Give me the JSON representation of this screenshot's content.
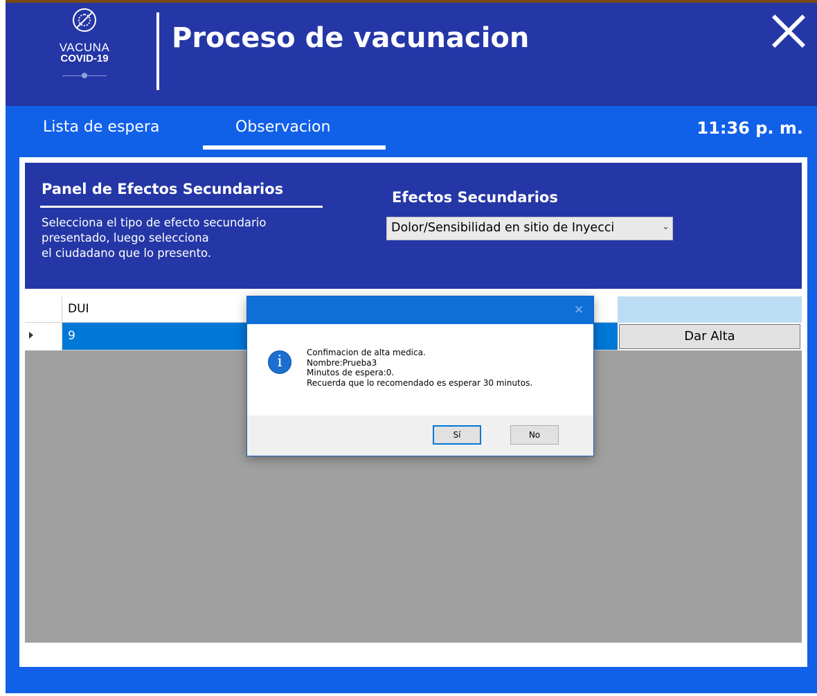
{
  "header": {
    "logo": {
      "line1": "VACUNA",
      "line2": "COVID-19"
    },
    "title": "Proceso de vacunacion",
    "close_icon": "close-icon"
  },
  "tabs": [
    {
      "label": "Lista de espera",
      "active": false
    },
    {
      "label": "Observacion",
      "active": true
    }
  ],
  "clock": "11:36 p. m.",
  "panel": {
    "title": "Panel de Efectos Secundarios",
    "description": [
      "Selecciona el tipo de efecto secundario",
      "presentado, luego selecciona",
      "el ciudadano que lo presento."
    ],
    "effects_label": "Efectos Secundarios",
    "effects_selected": "Dolor/Sensibilidad en sitio de Inyecci"
  },
  "grid": {
    "columns": [
      "DUI"
    ],
    "rows": [
      {
        "dui": "9",
        "action": "Dar Alta"
      }
    ]
  },
  "dialog": {
    "title": "",
    "icon": "info-icon",
    "message": [
      "Confimacion de alta medica.",
      "Nombre:Prueba3",
      "Minutos de espera:0.",
      "Recuerda que lo recomendado es esperar 30 minutos."
    ],
    "yes_label": "Sí",
    "no_label": "No"
  },
  "colors": {
    "header_bg": "#2537a6",
    "app_bg": "#1160e8",
    "selection": "#0078d7",
    "grid_bg": "#a0a0a0"
  }
}
